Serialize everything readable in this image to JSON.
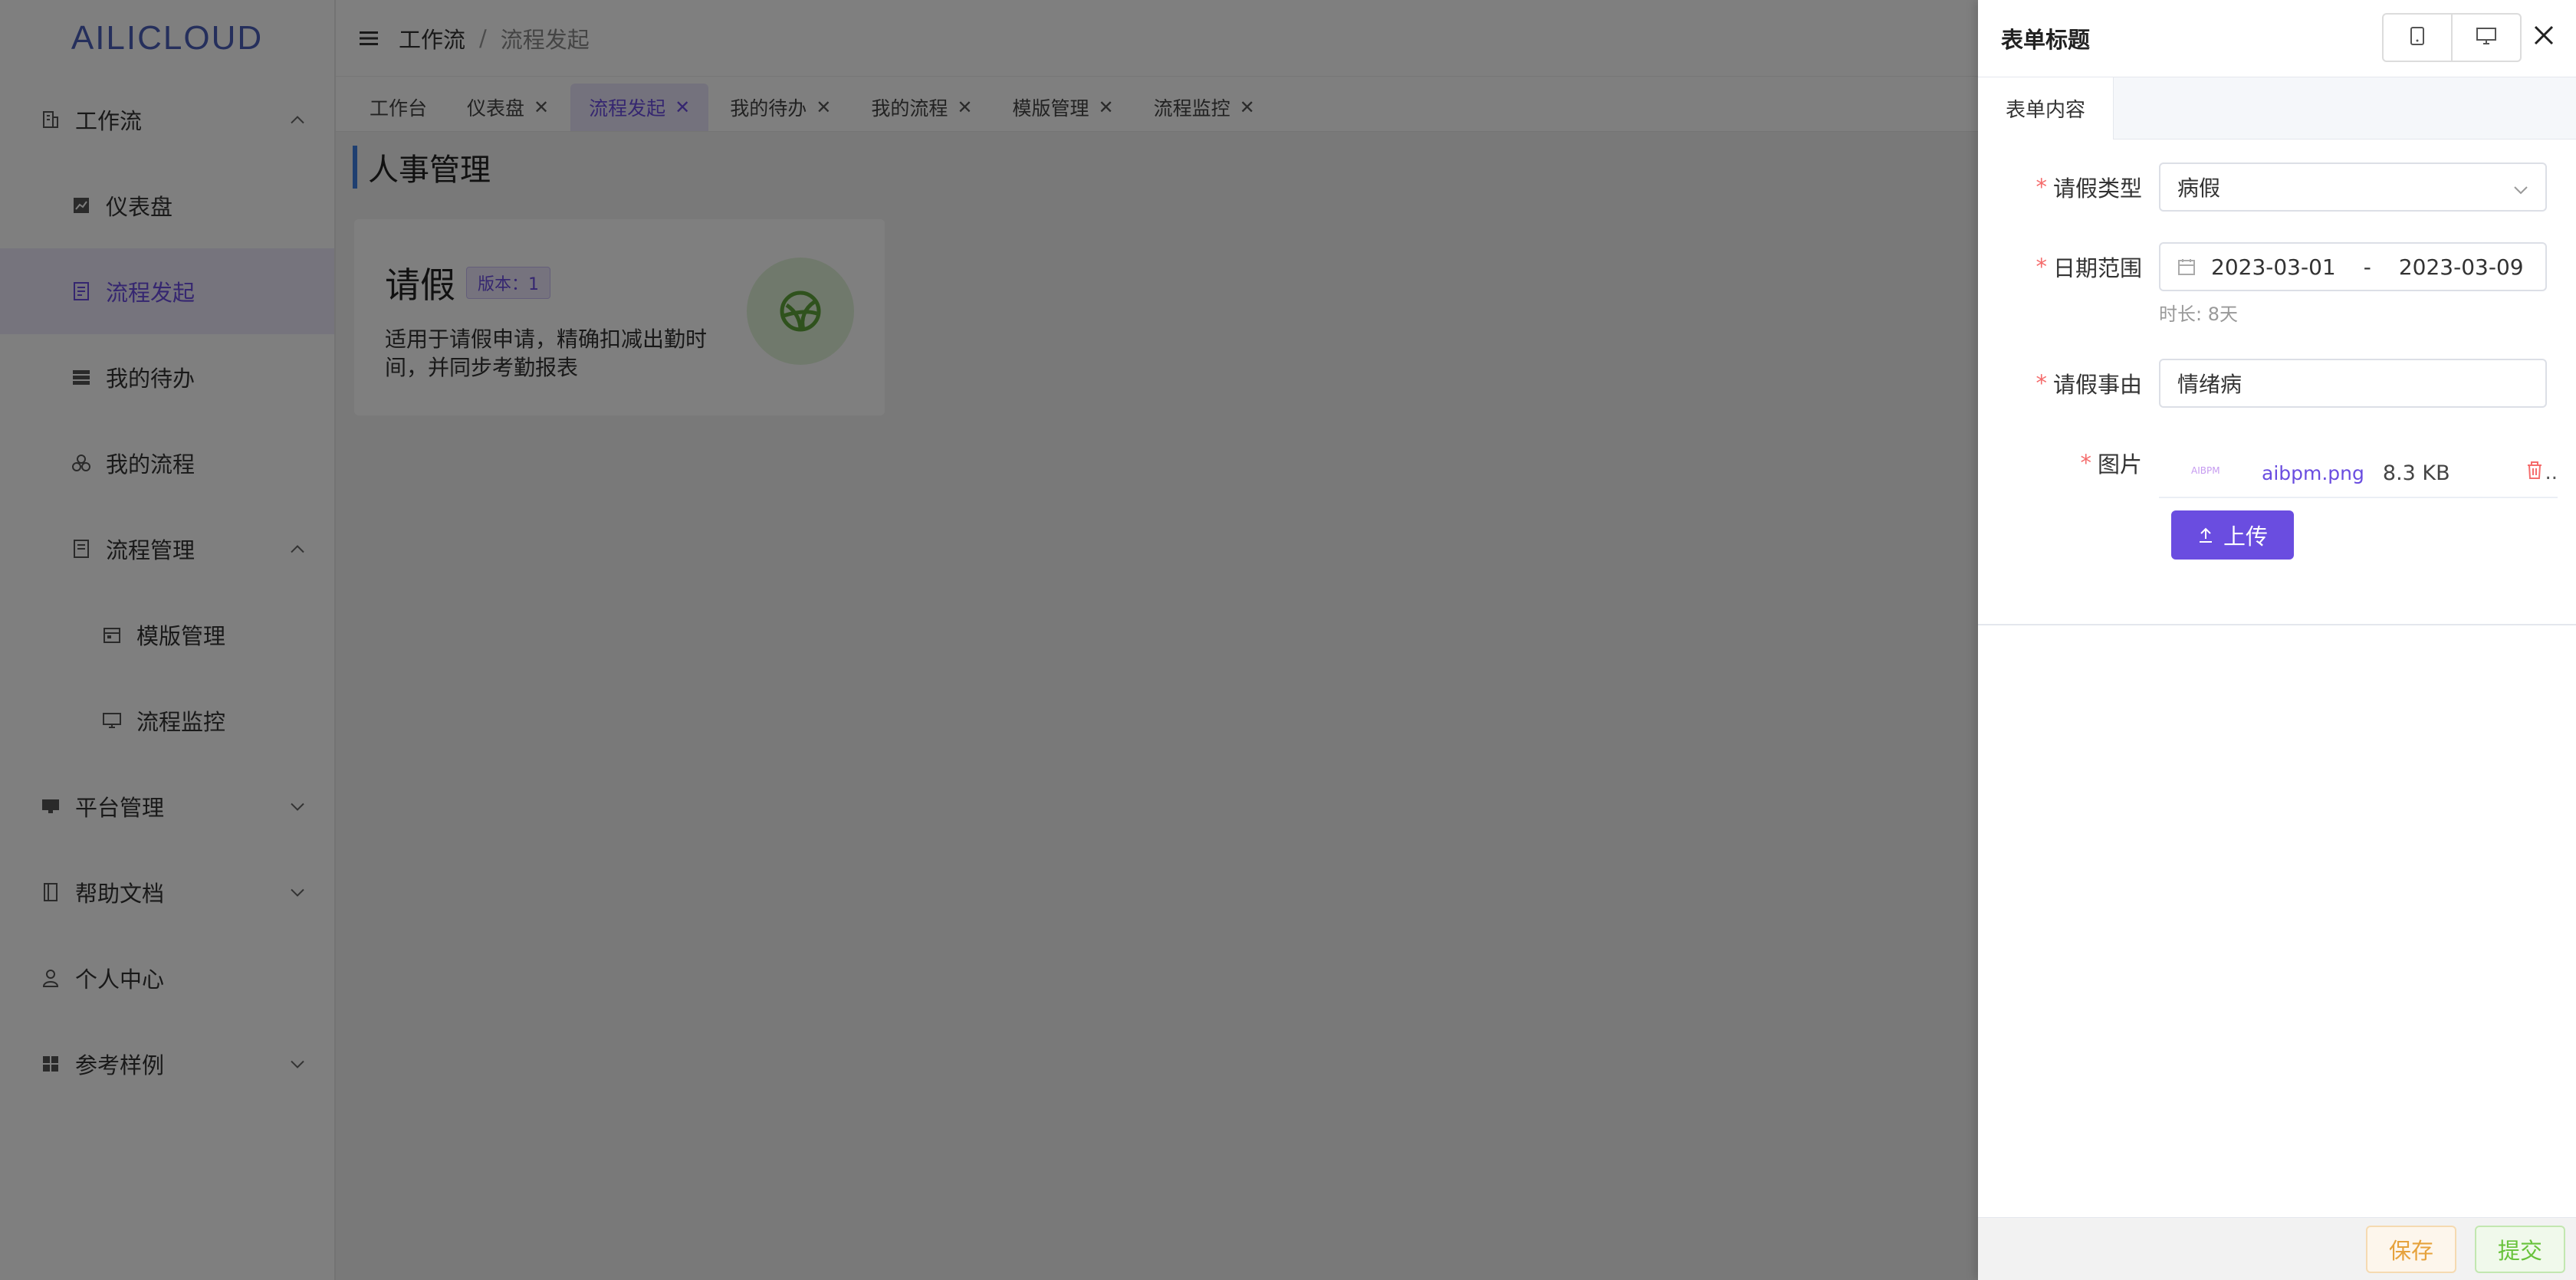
{
  "app": {
    "logo": "AILICLOUD"
  },
  "sidebar": {
    "items": [
      {
        "label": "工作流",
        "expanded": true
      },
      {
        "label": "仪表盘"
      },
      {
        "label": "流程发起",
        "active": true
      },
      {
        "label": "我的待办"
      },
      {
        "label": "我的流程"
      },
      {
        "label": "流程管理",
        "expanded": true
      },
      {
        "label": "模版管理"
      },
      {
        "label": "流程监控"
      },
      {
        "label": "平台管理"
      },
      {
        "label": "帮助文档"
      },
      {
        "label": "个人中心"
      },
      {
        "label": "参考样例"
      }
    ]
  },
  "breadcrumb": {
    "level1": "工作流",
    "separator": "/",
    "level2": "流程发起"
  },
  "tabs": [
    {
      "label": "工作台"
    },
    {
      "label": "仪表盘"
    },
    {
      "label": "流程发起",
      "active": true
    },
    {
      "label": "我的待办"
    },
    {
      "label": "我的流程"
    },
    {
      "label": "模版管理"
    },
    {
      "label": "流程监控"
    }
  ],
  "page": {
    "title": "人事管理",
    "card": {
      "name": "请假",
      "version": "版本：1",
      "description": "适用于请假申请，精确扣减出勤时间，并同步考勤报表"
    }
  },
  "drawer": {
    "title": "表单标题",
    "tab": "表单内容",
    "form": {
      "leave_type": {
        "label": "请假类型",
        "value": "病假"
      },
      "date_range": {
        "label": "日期范围",
        "start": "2023-03-01",
        "separator": "-",
        "end": "2023-03-09",
        "hint": "时长: 8天"
      },
      "reason": {
        "label": "请假事由",
        "value": "情绪病"
      },
      "image": {
        "label": "图片",
        "file_name": "aibpm.png",
        "file_size": "8.3 KB",
        "thumb_text": "AIBPM"
      },
      "upload_label": "上传"
    },
    "footer": {
      "save_label": "保存",
      "submit_label": "提交"
    }
  },
  "colors": {
    "accent": "#6a4de0",
    "warning": "#e6a23c",
    "success": "#67c23a",
    "danger": "#f56c6c"
  }
}
